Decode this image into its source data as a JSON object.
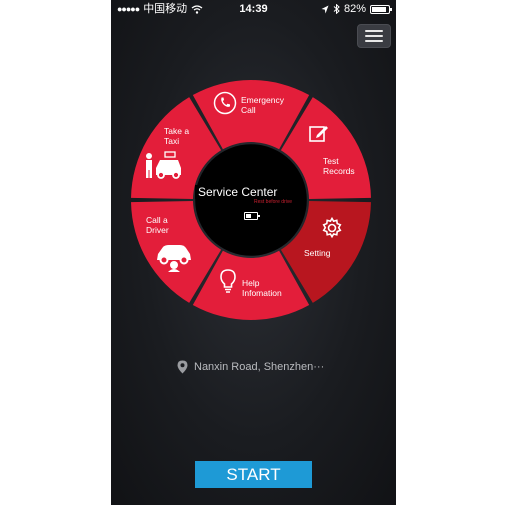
{
  "status_bar": {
    "carrier": "中国移动",
    "time": "14:39",
    "battery_percent": "82%",
    "battery_level": 0.82,
    "signal_icon": "signal-dots-icon",
    "wifi_icon": "wifi-icon",
    "location_icon": "location-arrow-icon",
    "bluetooth_icon": "bluetooth-icon"
  },
  "menu": {
    "icon": "hamburger-menu-icon"
  },
  "wheel": {
    "center_title": "Service Center",
    "center_subtitle": "Rest before drive",
    "center_icon": "battery-icon",
    "segments": [
      {
        "label_line1": "Emergency",
        "label_line2": "Call",
        "icon": "phone-icon"
      },
      {
        "label_line1": "Test",
        "label_line2": "Records",
        "icon": "edit-icon"
      },
      {
        "label_line1": "Setting",
        "label_line2": "",
        "icon": "gear-icon"
      },
      {
        "label_line1": "Help",
        "label_line2": "Infomation",
        "icon": "lightbulb-icon"
      },
      {
        "label_line1": "Call a",
        "label_line2": "Driver",
        "icon": "car-driver-icon"
      },
      {
        "label_line1": "Take a",
        "label_line2": "Taxi",
        "icon": "taxi-icon"
      }
    ],
    "colors": {
      "segment": "#e31e3a",
      "segment_dark": "#b8161f",
      "center": "#000000"
    }
  },
  "location": {
    "text": "Nanxin Road, Shenzhen···",
    "icon": "map-pin-icon"
  },
  "start_button": {
    "label": "START",
    "color": "#1e9ad6"
  }
}
